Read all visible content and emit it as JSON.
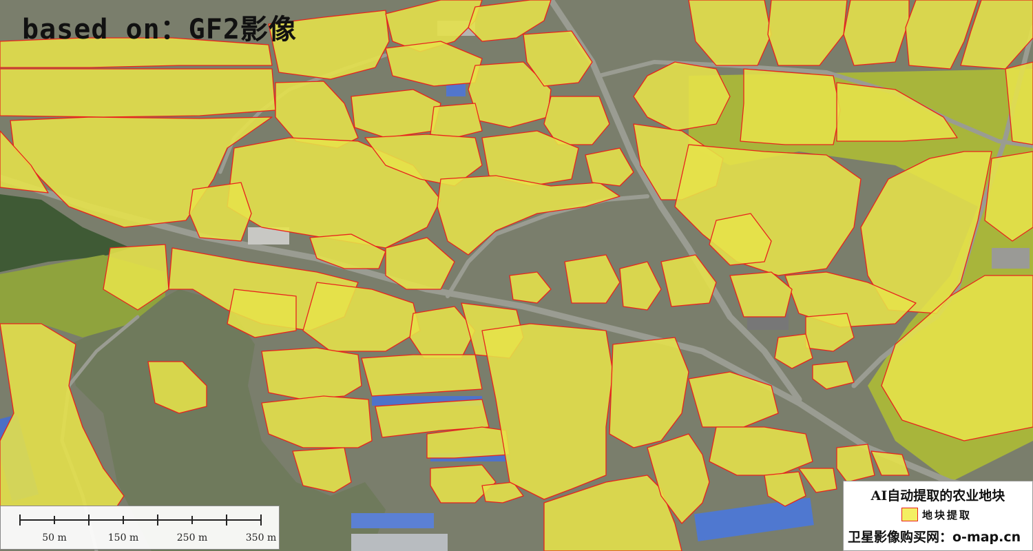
{
  "map": {
    "title": "based on：GF2影像",
    "colors": {
      "parcel_fill": "#e6e24a",
      "parcel_outline": "#e8221c",
      "road": "#9a9c92",
      "bare_ground": "#7a7e6c",
      "forest": "#3f5a35",
      "roof_blue": "#4d72c8"
    },
    "scale_bar": {
      "labels": [
        "50 m",
        "150 m",
        "250 m",
        "350 m"
      ]
    },
    "legend": {
      "title": "AI自动提取的农业地块",
      "item_label": "地块提取",
      "credit": "卫星影像购买网：o-map.cn"
    }
  }
}
